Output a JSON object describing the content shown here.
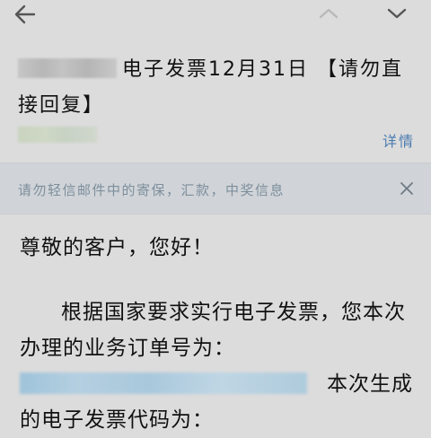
{
  "toolbar": {
    "back_icon": "arrow-left-icon",
    "prev_icon": "chevron-up-icon",
    "next_icon": "chevron-down-icon"
  },
  "email": {
    "subject": "电子发票12月31日 【请勿直接回复】",
    "details_link": "详情",
    "warning_text": "请勿轻信邮件中的寄保，汇款，中奖信息",
    "greeting": "尊敬的客户，您好！",
    "paragraph_a": "根据国家要求实行电子发票，您本次办理的业务订单号为：",
    "paragraph_b": "本次生成的电子发票代码为："
  },
  "colors": {
    "background": "#dcdcdc",
    "link": "#4a7bb0",
    "warning_bg": "#d0d4d8",
    "warning_text": "#7d8e9c"
  }
}
